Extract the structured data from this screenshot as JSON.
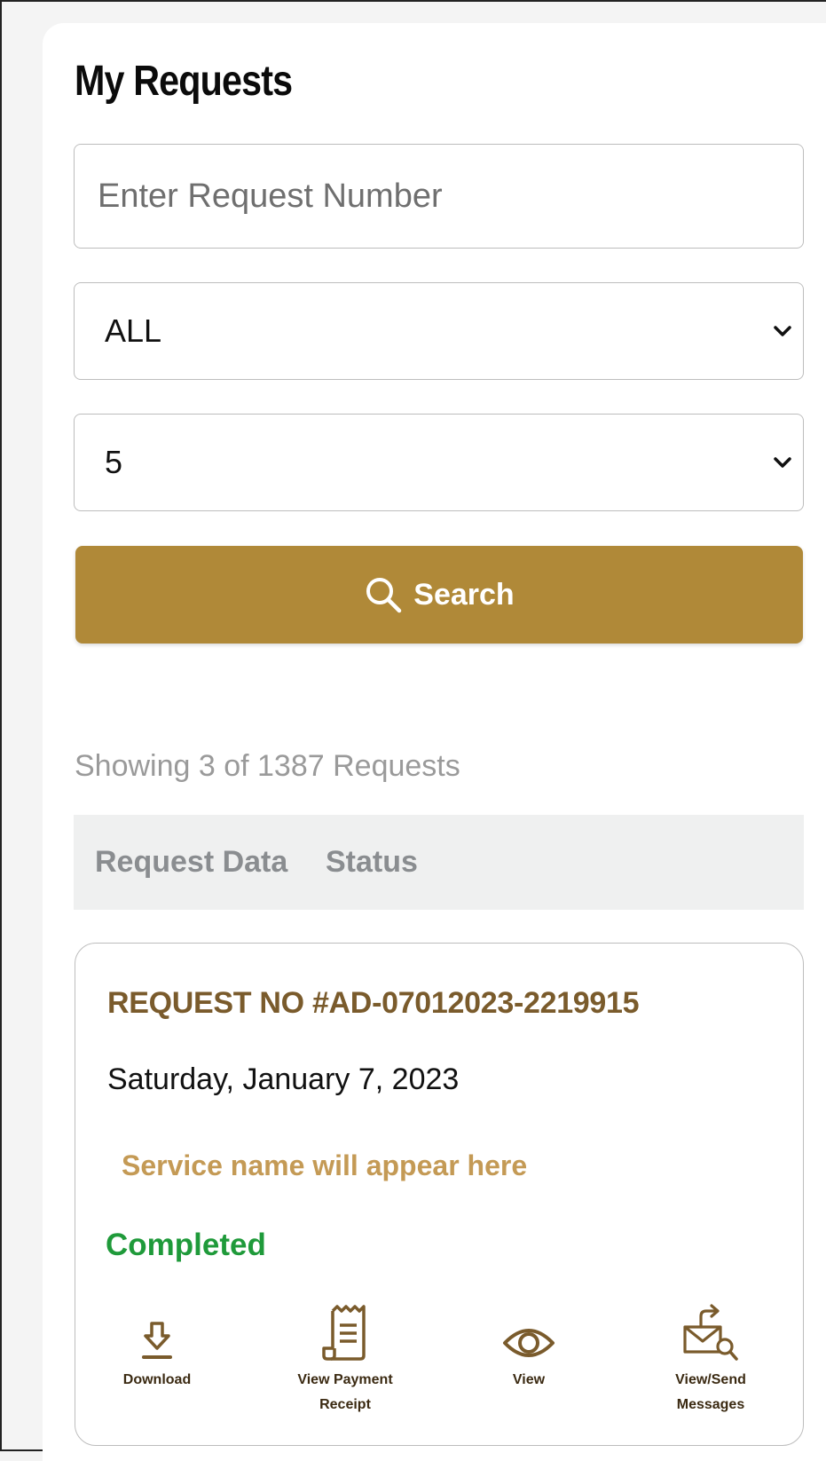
{
  "page": {
    "title": "My Requests"
  },
  "search": {
    "placeholder": "Enter Request Number",
    "status_filter": {
      "selected": "ALL"
    },
    "page_size": {
      "selected": "5"
    },
    "button_label": "Search"
  },
  "results": {
    "summary": "Showing 3 of 1387 Requests",
    "columns": [
      "Request Data",
      "Status"
    ]
  },
  "request": {
    "number": "REQUEST NO #AD-07012023-2219915",
    "date": "Saturday, January 7, 2023",
    "service_name": "Service name will appear here",
    "status": "Completed",
    "actions": {
      "download": "Download",
      "receipt_line1": "View Payment",
      "receipt_line2": "Receipt",
      "view": "View",
      "messages_line1": "View/Send",
      "messages_line2": "Messages"
    }
  },
  "colors": {
    "accent": "#b08938",
    "request_number": "#7a5b2c",
    "service_name": "#c49a55",
    "status_completed": "#1f9a3a"
  },
  "icons": [
    "search-icon",
    "chevron-down-icon",
    "download-icon",
    "receipt-icon",
    "eye-icon",
    "messages-icon"
  ]
}
